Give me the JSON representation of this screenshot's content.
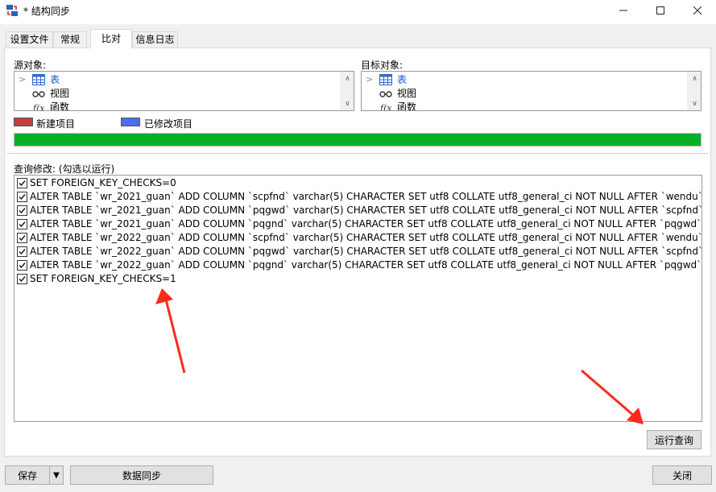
{
  "window": {
    "title": "* 结构同步",
    "min_glyph": "—",
    "max_glyph": "☐",
    "close_glyph": "✕"
  },
  "tabs": [
    {
      "label": "设置文件",
      "active": false
    },
    {
      "label": "常规",
      "active": false
    },
    {
      "label": "比对",
      "active": true
    },
    {
      "label": "信息日志",
      "active": false
    }
  ],
  "source": {
    "label": "源对象:",
    "items": [
      {
        "label": "表",
        "icon": "table-icon",
        "expandable": true
      },
      {
        "label": "视图",
        "icon": "view-icon",
        "expandable": false
      },
      {
        "label": "函数",
        "icon": "function-icon",
        "expandable": false
      }
    ]
  },
  "target": {
    "label": "目标对象:",
    "items": [
      {
        "label": "表",
        "icon": "table-icon",
        "expandable": true
      },
      {
        "label": "视图",
        "icon": "view-icon",
        "expandable": false
      },
      {
        "label": "函数",
        "icon": "function-icon",
        "expandable": false
      }
    ]
  },
  "legend": {
    "new_label": "新建项目",
    "new_color": "#c04040",
    "modified_label": "已修改项目",
    "modified_color": "#4a6ef0"
  },
  "progress": {
    "value": 1.0,
    "color": "#06b025"
  },
  "query": {
    "label": "查询修改: (勾选以运行)",
    "statements": [
      {
        "checked": true,
        "text": "SET FOREIGN_KEY_CHECKS=0"
      },
      {
        "checked": true,
        "text": "ALTER TABLE `wr_2021_guan` ADD COLUMN `scpfnd`  varchar(5) CHARACTER SET utf8 COLLATE utf8_general_ci NOT NULL AFTER `wendu`"
      },
      {
        "checked": true,
        "text": "ALTER TABLE `wr_2021_guan` ADD COLUMN `pqgwd`  varchar(5) CHARACTER SET utf8 COLLATE utf8_general_ci NOT NULL AFTER `scpfnd`"
      },
      {
        "checked": true,
        "text": "ALTER TABLE `wr_2021_guan` ADD COLUMN `pqgnd`  varchar(5) CHARACTER SET utf8 COLLATE utf8_general_ci NOT NULL AFTER `pqgwd`"
      },
      {
        "checked": true,
        "text": "ALTER TABLE `wr_2022_guan` ADD COLUMN `scpfnd`  varchar(5) CHARACTER SET utf8 COLLATE utf8_general_ci NOT NULL AFTER `wendu`"
      },
      {
        "checked": true,
        "text": "ALTER TABLE `wr_2022_guan` ADD COLUMN `pqgwd`  varchar(5) CHARACTER SET utf8 COLLATE utf8_general_ci NOT NULL AFTER `scpfnd`"
      },
      {
        "checked": true,
        "text": "ALTER TABLE `wr_2022_guan` ADD COLUMN `pqgnd`  varchar(5) CHARACTER SET utf8 COLLATE utf8_general_ci NOT NULL AFTER `pqgwd`"
      },
      {
        "checked": true,
        "text": "SET FOREIGN_KEY_CHECKS=1"
      }
    ]
  },
  "buttons": {
    "run_query": "运行查询",
    "save": "保存",
    "save_dropdown_glyph": "▼",
    "data_sync": "数据同步",
    "close": "关闭"
  },
  "annotation_color": "#ff2a1a"
}
